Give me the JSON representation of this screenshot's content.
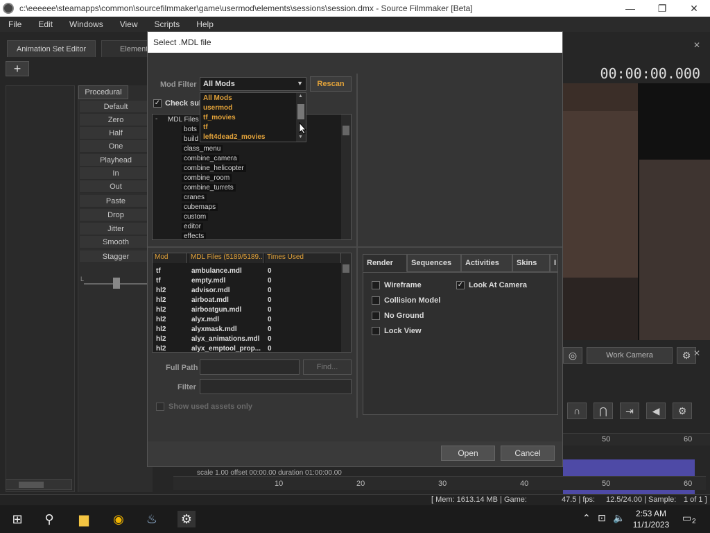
{
  "window": {
    "title": "c:\\eeeeee\\steamapps\\common\\sourcefilmmaker\\game\\usermod\\elements\\sessions\\session.dmx - Source Filmmaker [Beta]",
    "minimize": "—",
    "maximize": "❐",
    "close": "✕"
  },
  "menu": [
    "File",
    "Edit",
    "Windows",
    "View",
    "Scripts",
    "Help"
  ],
  "tabs": {
    "animation_set_editor": "Animation Set Editor",
    "element": "Element"
  },
  "procedural": {
    "tab": "Procedural",
    "buttons": [
      "Default",
      "Zero",
      "Half",
      "One",
      "Playhead",
      "In",
      "Out",
      "Paste",
      "Drop",
      "Jitter",
      "Smooth",
      "Stagger"
    ],
    "slider_label": "L"
  },
  "viewer": {
    "timecode": "00:00:00.000",
    "work_camera": "Work Camera"
  },
  "timeline": {
    "ruler_top": [
      "50",
      "60"
    ],
    "ruler_bottom": [
      "10",
      "20",
      "30",
      "40",
      "50",
      "60"
    ],
    "scale_info": "scale 1.00  offset  00:00.00  duration  01:00:00.00"
  },
  "status": {
    "mem": "[ Mem:  1613.14 MB | Game:",
    "game": "47.5 | fps:",
    "fps": "12.5/24.00 | Sample:",
    "sample": "1 of 1 ]"
  },
  "dialog": {
    "title": "Select .MDL file",
    "mod_filter_label": "Mod Filter",
    "mod_filter_value": "All Mods",
    "rescan": "Rescan",
    "check_sub": "Check sub",
    "dropdown_options": [
      "All Mods",
      "usermod",
      "tf_movies",
      "tf",
      "left4dead2_movies"
    ],
    "tree_root": "MDL Files",
    "tree_items": [
      "bots",
      "build",
      "class_menu",
      "combine_camera",
      "combine_helicopter",
      "combine_room",
      "combine_turrets",
      "cranes",
      "cubemaps",
      "custom",
      "editor",
      "effects"
    ],
    "table_headers": [
      "Mod",
      "MDL Files (5189/5189...",
      "Times Used"
    ],
    "table_rows": [
      {
        "mod": "tf",
        "file": "ambulance.mdl",
        "times": "0"
      },
      {
        "mod": "tf",
        "file": "empty.mdl",
        "times": "0"
      },
      {
        "mod": "hl2",
        "file": "advisor.mdl",
        "times": "0"
      },
      {
        "mod": "hl2",
        "file": "airboat.mdl",
        "times": "0"
      },
      {
        "mod": "hl2",
        "file": "airboatgun.mdl",
        "times": "0"
      },
      {
        "mod": "hl2",
        "file": "alyx.mdl",
        "times": "0"
      },
      {
        "mod": "hl2",
        "file": "alyxmask.mdl",
        "times": "0"
      },
      {
        "mod": "hl2",
        "file": "alyx_animations.mdl",
        "times": "0"
      },
      {
        "mod": "hl2",
        "file": "alyx_emptool_prop...",
        "times": "0"
      }
    ],
    "full_path_label": "Full Path",
    "find": "Find...",
    "filter_label": "Filter",
    "show_used": "Show used assets only",
    "right_tabs": [
      "Render",
      "Sequences",
      "Activities",
      "Skins",
      "I"
    ],
    "options": {
      "wireframe": "Wireframe",
      "look_at_camera": "Look At Camera",
      "collision_model": "Collision Model",
      "no_ground": "No Ground",
      "lock_view": "Lock View"
    },
    "open": "Open",
    "cancel": "Cancel"
  },
  "taskbar": {
    "time": "2:53 AM",
    "date": "11/1/2023",
    "notification_count": "2"
  }
}
